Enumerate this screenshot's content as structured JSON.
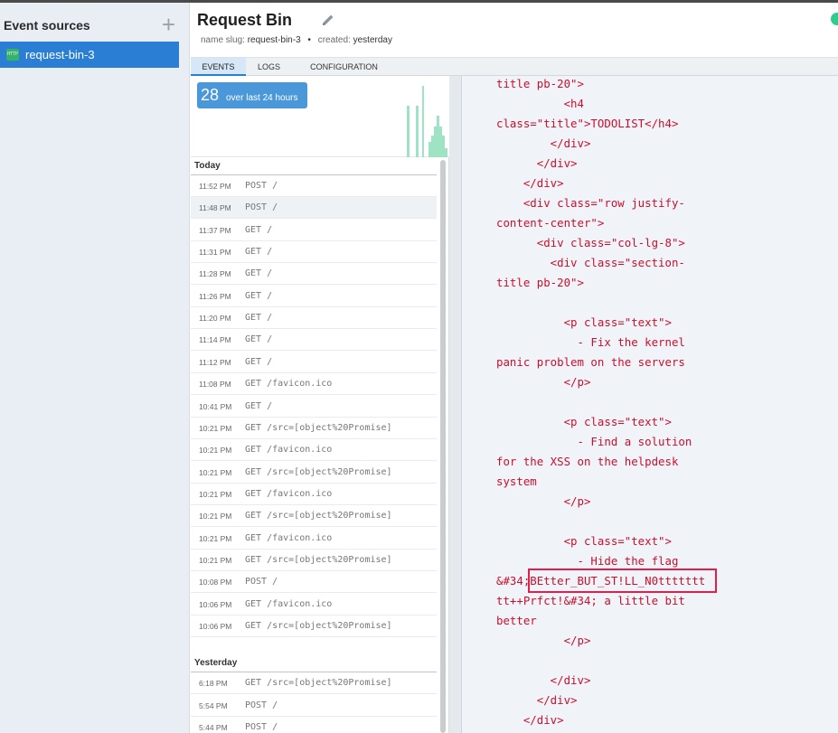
{
  "sidebar": {
    "title": "Event sources",
    "items": [
      {
        "label": "request-bin-3",
        "badge": "HTTP"
      }
    ]
  },
  "header": {
    "title": "Request Bin",
    "meta": {
      "slug_label": "name slug:",
      "slug_value": "request-bin-3",
      "sep": "•",
      "created_label": "created:",
      "created_value": "yesterday"
    }
  },
  "tabs": [
    "EVENTS",
    "LOGS",
    "CONFIGURATION"
  ],
  "stats": {
    "count": "28",
    "label": "over last 24 hours"
  },
  "events": {
    "today_label": "Today",
    "yesterday_label": "Yesterday",
    "today": [
      {
        "time": "11:52 PM",
        "req": "POST /"
      },
      {
        "time": "11:48 PM",
        "req": "POST /"
      },
      {
        "time": "11:37 PM",
        "req": "GET /"
      },
      {
        "time": "11:31 PM",
        "req": "GET /"
      },
      {
        "time": "11:28 PM",
        "req": "GET /"
      },
      {
        "time": "11:26 PM",
        "req": "GET /"
      },
      {
        "time": "11:20 PM",
        "req": "GET /"
      },
      {
        "time": "11:14 PM",
        "req": "GET /"
      },
      {
        "time": "11:12 PM",
        "req": "GET /"
      },
      {
        "time": "11:08 PM",
        "req": "GET /favicon.ico"
      },
      {
        "time": "10:41 PM",
        "req": "GET /"
      },
      {
        "time": "10:21 PM",
        "req": "GET /src=[object%20Promise]"
      },
      {
        "time": "10:21 PM",
        "req": "GET /favicon.ico"
      },
      {
        "time": "10:21 PM",
        "req": "GET /src=[object%20Promise]"
      },
      {
        "time": "10:21 PM",
        "req": "GET /favicon.ico"
      },
      {
        "time": "10:21 PM",
        "req": "GET /src=[object%20Promise]"
      },
      {
        "time": "10:21 PM",
        "req": "GET /favicon.ico"
      },
      {
        "time": "10:21 PM",
        "req": "GET /src=[object%20Promise]"
      },
      {
        "time": "10:08 PM",
        "req": "POST /"
      },
      {
        "time": "10:06 PM",
        "req": "GET /favicon.ico"
      },
      {
        "time": "10:06 PM",
        "req": "GET /src=[object%20Promise]"
      }
    ],
    "yesterday": [
      {
        "time": "6:18 PM",
        "req": "GET /src=[object%20Promise]"
      },
      {
        "time": "5:54 PM",
        "req": "POST /"
      },
      {
        "time": "5:44 PM",
        "req": "POST /"
      }
    ]
  },
  "code_lines": [
    "title pb-20\">",
    "          <h4",
    "class=\"title\">TODOLIST</h4>",
    "        </div>",
    "      </div>",
    "    </div>",
    "    <div class=\"row justify-",
    "content-center\">",
    "      <div class=\"col-lg-8\">",
    "        <div class=\"section-",
    "title pb-20\">",
    "",
    "          <p class=\"text\">",
    "            - Fix the kernel",
    "panic problem on the servers",
    "          </p>",
    "",
    "          <p class=\"text\">",
    "            - Find a solution",
    "for the XSS on the helpdesk",
    "system",
    "          </p>",
    "",
    "          <p class=\"text\">",
    "            - Hide the flag",
    "&#34;BEtter_BUT_ST!LL_N0ttttttt",
    "tt++Prfct!&#34; a little bit",
    "better",
    "          </p>",
    "",
    "        </div>",
    "      </div>",
    "    </div>"
  ],
  "colors": {
    "accent": "#2a7fd4",
    "badge_bg": "#4a98d9",
    "code_text": "#c8102e",
    "highlight_box": "#e0204a",
    "status_online": "#2ecc8f",
    "spark": "#9ee3c4"
  },
  "icons": {
    "add": "plus-icon",
    "edit": "pencil-icon",
    "status": "status-dot-icon",
    "source": "http-icon"
  }
}
